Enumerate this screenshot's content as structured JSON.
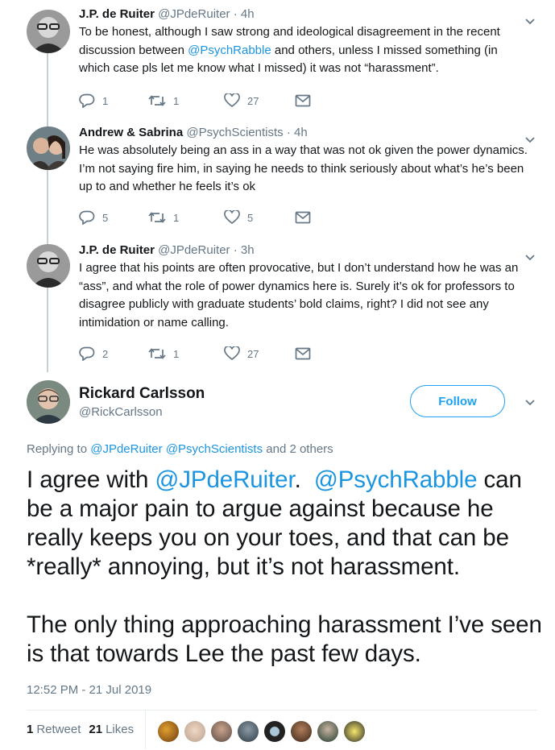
{
  "replies": [
    {
      "name": "J.P. de Ruiter",
      "handle": "@JPdeRuiter",
      "time": "· 4h",
      "text_parts": [
        {
          "t": "To be honest, although I saw strong and ideological disagreement in the recent discussion between ",
          "m": false
        },
        {
          "t": "@PsychRabble",
          "m": true
        },
        {
          "t": " and others, unless I missed something (in which case pls let me know what I missed) it was not “harassment”.",
          "m": false
        }
      ],
      "replies_count": "1",
      "retweets_count": "1",
      "likes_count": "27"
    },
    {
      "name": "Andrew & Sabrina",
      "handle": "@PsychScientists",
      "time": "· 4h",
      "text_parts": [
        {
          "t": "He was absolutely being an ass in a way that was not ok given the power dynamics.  I’m not saying fire him, in saying he needs to think seriously about what’s he’s been up to and whether he feels it’s ok",
          "m": false
        }
      ],
      "replies_count": "5",
      "retweets_count": "1",
      "likes_count": "5"
    },
    {
      "name": "J.P. de Ruiter",
      "handle": "@JPdeRuiter",
      "time": "· 3h",
      "text_parts": [
        {
          "t": "I agree that his points are often provocative, but I don’t understand how he was an “ass”, and what the role of power dynamics here is. Surely it’s ok for professors to disagree publicly with graduate students’ bold claims, right? I did not see any intimidation or name calling.",
          "m": false
        }
      ],
      "replies_count": "2",
      "retweets_count": "1",
      "likes_count": "27"
    }
  ],
  "main_tweet": {
    "name": "Rickard Carlsson",
    "handle": "@RickCarlsson",
    "follow_label": "Follow",
    "replying_prefix": "Replying to ",
    "replying_mentions": "@JPdeRuiter @PsychScientists",
    "replying_suffix": " and 2 others",
    "para1_parts": [
      {
        "t": "I agree with ",
        "m": false
      },
      {
        "t": "@JPdeRuiter",
        "m": true
      },
      {
        "t": ".  ",
        "m": false
      },
      {
        "t": "@PsychRabble",
        "m": true
      },
      {
        "t": " can be a major pain to argue against because he really keeps you on your toes, and that can be *really* annoying, but it’s not harassment.",
        "m": false
      }
    ],
    "para2": "The only thing approaching harassment I’ve seen is that towards Lee the past few days.",
    "timestamp": "12:52 PM - 21 Jul 2019",
    "retweets_count": "1",
    "retweets_label": "Retweet",
    "likes_count": "21",
    "likes_label": "Likes"
  },
  "colors": {
    "accent": "#1da1f2",
    "mention": "#1b95e0",
    "muted": "#657786",
    "thread_line": "#c4cfd6"
  },
  "icons": [
    "reply-icon",
    "retweet-icon",
    "heart-icon",
    "message-icon",
    "chevron-down-icon"
  ]
}
